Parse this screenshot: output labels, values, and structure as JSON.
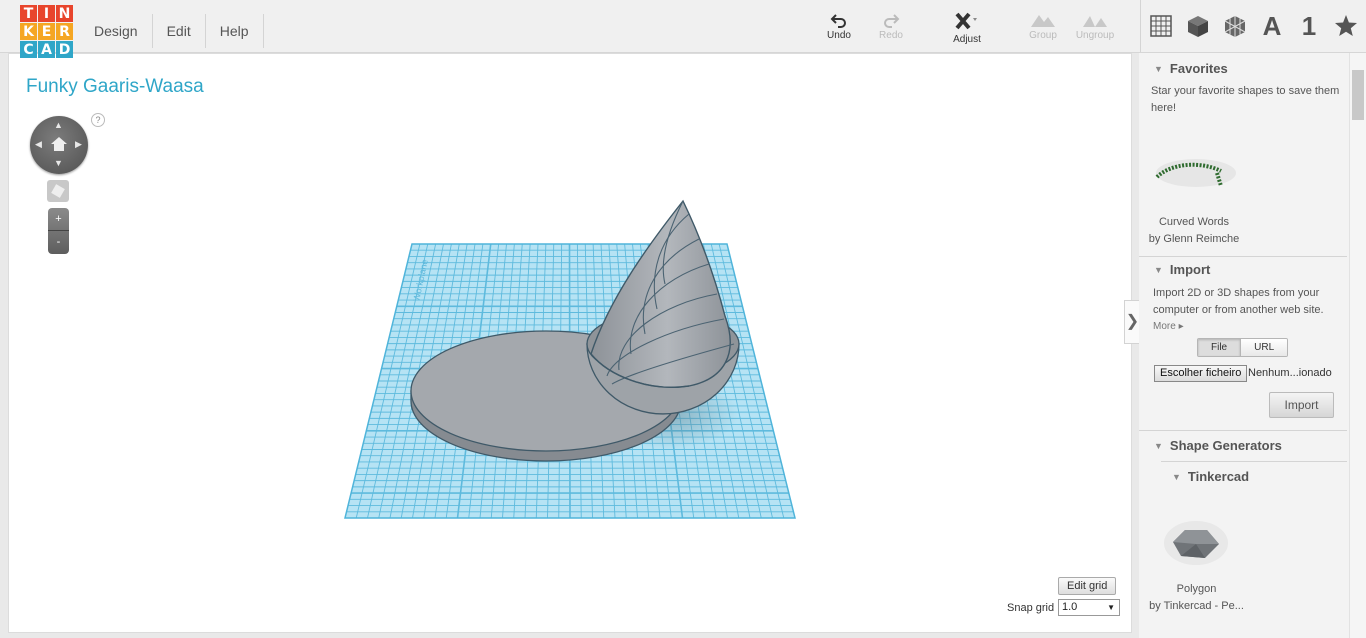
{
  "logo": {
    "letters": [
      "T",
      "I",
      "N",
      "K",
      "E",
      "R",
      "C",
      "A",
      "D"
    ],
    "colors": [
      "#e8452c",
      "#e8452c",
      "#e8452c",
      "#f5a623",
      "#f5a623",
      "#f5a623",
      "#2fa6c8",
      "#2fa6c8",
      "#2fa6c8"
    ]
  },
  "menu": {
    "items": [
      "Design",
      "Edit",
      "Help"
    ]
  },
  "toolbar": {
    "undo": "Undo",
    "redo": "Redo",
    "adjust": "Adjust",
    "group": "Group",
    "ungroup": "Ungroup"
  },
  "view_icons": {
    "letter": "A",
    "number": "1",
    "icons": [
      "grid-view-icon",
      "box-view-icon",
      "wireframe-view-icon",
      "text-view-icon",
      "number-view-icon",
      "star-view-icon"
    ]
  },
  "document": {
    "title": "Funky Gaaris-Waasa"
  },
  "workplane": {
    "label": "Workplane",
    "edit_grid": "Edit grid",
    "snap_label": "Snap grid",
    "snap_value": "1.0"
  },
  "nav": {
    "help": "?",
    "zoom_in": "+",
    "zoom_out": "-"
  },
  "sidebar": {
    "favorites": {
      "title": "Favorites",
      "description": "Star your favorite shapes to save them here!",
      "item_name": "Curved Words",
      "item_author": "by Glenn Reimche"
    },
    "import": {
      "title": "Import",
      "description": "Import 2D or 3D shapes from your computer or from another web site.",
      "more": "More",
      "tab_file": "File",
      "tab_url": "URL",
      "choose_file": "Escolher ficheiro",
      "file_name": "Nenhum...ionado",
      "button": "Import"
    },
    "shape_generators": {
      "title": "Shape Generators",
      "subtitle": "Tinkercad",
      "item_name": "Polygon",
      "item_author": "by Tinkercad - Pe..."
    }
  },
  "colors": {
    "accent": "#2fa6c8",
    "grid": "#6cc5e6",
    "shape": "#9a9fa5"
  }
}
